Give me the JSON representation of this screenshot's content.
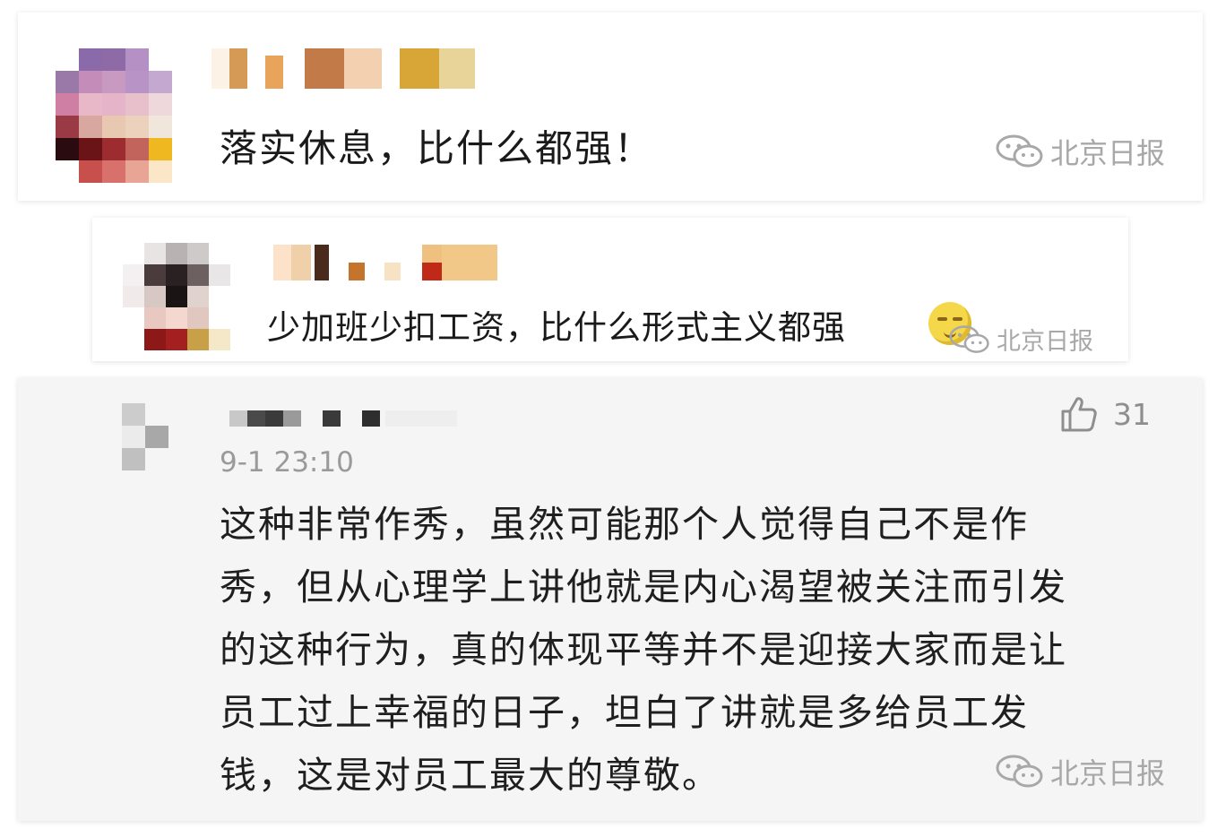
{
  "comments": [
    {
      "text": "落实休息，比什么都强！",
      "watermark": "北京日报"
    },
    {
      "text": "少加班少扣工资，比什么形式主义都强",
      "emoji_icon": "smile-emoji-icon",
      "watermark": "北京日报"
    },
    {
      "time": "9-1 23:10",
      "likes": "31",
      "lines": [
        "这种非常作秀，虽然可能那个人觉得自己不是作",
        "秀，但从心理学上讲他就是内心渴望被关注而引发",
        "的这种行为，真的体现平等并不是迎接大家而是让",
        "员工过上幸福的日子，坦白了讲就是多给员工发",
        "钱，这是对员工最大的尊敬。"
      ],
      "watermark": "北京日报"
    }
  ],
  "colors": {
    "card_bg": "#ffffff",
    "card3_bg": "#f5f5f5",
    "text": "#1a1a1a",
    "muted": "#9a9a9a",
    "watermark": "#a8a8a8"
  }
}
